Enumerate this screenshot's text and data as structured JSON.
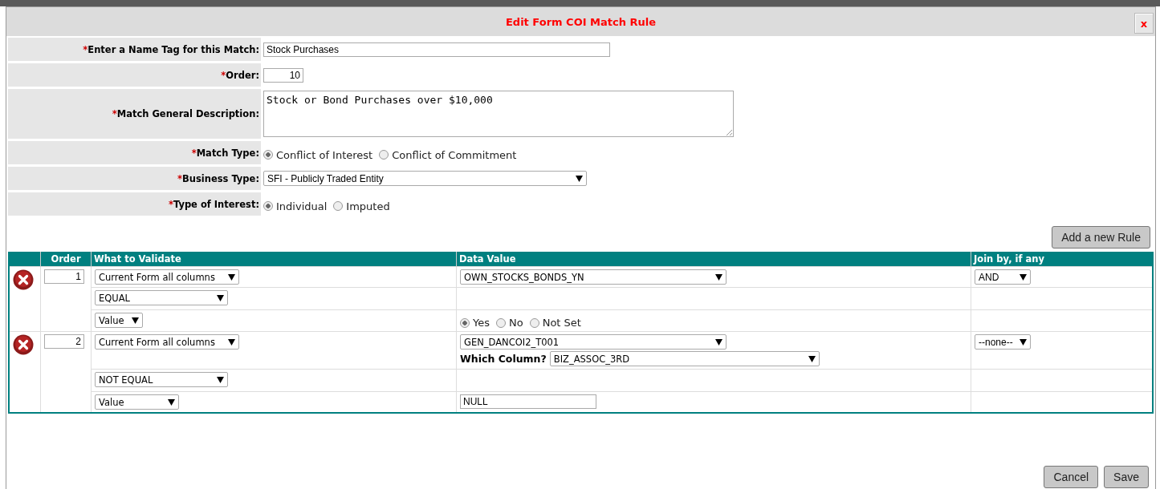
{
  "dialog": {
    "title": "Edit Form COI Match Rule",
    "close": "x"
  },
  "form": [
    {
      "kind": "text",
      "label": "Enter a Name Tag for this Match:",
      "required": "*",
      "value": "Stock Purchases"
    },
    {
      "kind": "number",
      "label": "Order:",
      "required": "*",
      "value": "10"
    },
    {
      "kind": "textarea",
      "label": "Match General Description:",
      "required": "*",
      "value": "Stock or Bond Purchases over $10,000"
    },
    {
      "kind": "radios",
      "label": "Match Type:",
      "required": "*",
      "options": [
        {
          "label": "Conflict of Interest",
          "selected": true
        },
        {
          "label": "Conflict of Commitment",
          "selected": false
        }
      ]
    },
    {
      "kind": "select",
      "label": "Business Type:",
      "required": "*",
      "value": "SFI - Publicly Traded Entity"
    },
    {
      "kind": "radios",
      "label": "Type of Interest:",
      "required": "*",
      "options": [
        {
          "label": "Individual",
          "selected": true
        },
        {
          "label": "Imputed",
          "selected": false
        }
      ]
    }
  ],
  "add_button": "Add a new Rule",
  "table": {
    "columns": [
      "Order",
      "What to Validate",
      "Data Value",
      "Join by, if any"
    ],
    "rules": [
      {
        "order": "1",
        "field": "Current Form all columns",
        "data_value": "OWN_STOCKS_BONDS_YN",
        "join": "AND",
        "operator": "EQUAL",
        "value_type": "Value",
        "value": {
          "kind": "radios",
          "options": [
            {
              "label": "Yes",
              "selected": true
            },
            {
              "label": "No",
              "selected": false
            },
            {
              "label": "Not Set",
              "selected": false
            }
          ]
        }
      },
      {
        "order": "2",
        "field": "Current Form all columns",
        "data_value": "GEN_DANCOI2_T001",
        "which_column_label": "Which Column?",
        "which_column": "BIZ_ASSOC_3RD",
        "join": "--none--",
        "operator": "NOT EQUAL",
        "value_type": "Value",
        "value": {
          "kind": "text",
          "value": "NULL"
        }
      }
    ]
  },
  "buttons": [
    "Cancel",
    "Save"
  ]
}
